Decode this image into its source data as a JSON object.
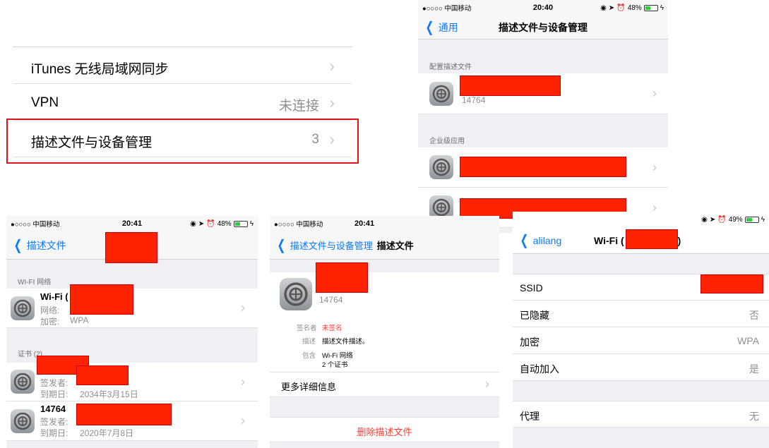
{
  "settings_excerpt": {
    "rows": [
      {
        "label": "iTunes 无线局域网同步",
        "value": ""
      },
      {
        "label": "VPN",
        "value": "未连接"
      },
      {
        "label": "描述文件与设备管理",
        "value": "3"
      }
    ]
  },
  "profiles_screen": {
    "status": {
      "carrier": "●○○○○ 中国移动",
      "time": "20:40",
      "battery": "48%"
    },
    "nav": {
      "back": "通用",
      "title": "描述文件与设备管理"
    },
    "sections": [
      {
        "header": "配置描述文件",
        "items": [
          {
            "sub": "14764"
          }
        ]
      },
      {
        "header": "企业级应用",
        "items": [
          {
            "sub": ""
          },
          {
            "sub": ""
          }
        ]
      }
    ]
  },
  "profile_detail_screen": {
    "status": {
      "carrier": "●○○○○ 中国移动",
      "time": "20:41",
      "battery": "48%"
    },
    "nav": {
      "back": "描述文件"
    },
    "wifi_header": "WI-FI 网络",
    "wifi": {
      "title": "Wi-Fi (",
      "network_label": "网络:",
      "encrypt_label": "加密:",
      "encrypt_value": "WPA"
    },
    "cert_header": "证书 (2)",
    "certs": [
      {
        "title": "",
        "issuer_label": "签发者:",
        "expiry_label": "到期日:",
        "expiry": "2034年3月15日"
      },
      {
        "title": "14764",
        "issuer_label": "签发者:",
        "expiry_label": "到期日:",
        "expiry": "2020年7月8日"
      }
    ]
  },
  "profile_screen": {
    "status": {
      "carrier": "●○○○○ 中国移动",
      "time": "20:41"
    },
    "nav": {
      "back": "描述文件与设备管理",
      "title": "描述文件"
    },
    "profile_sub": "14764",
    "signer_label": "签名者",
    "signer_value": "未签名",
    "desc_label": "描述",
    "desc_value": "描述文件描述。",
    "contains_label": "包含",
    "contains_value_1": "Wi-Fi 网络",
    "contains_value_2": "2 个证书",
    "more": "更多详细信息",
    "delete": "删除描述文件"
  },
  "wifi_screen": {
    "status": {
      "battery": "49%"
    },
    "nav": {
      "back": "alilang",
      "title_prefix": "Wi-Fi (",
      "title_suffix": ")"
    },
    "rows": [
      {
        "label": "SSID",
        "value": ""
      },
      {
        "label": "已隐藏",
        "value": "否"
      },
      {
        "label": "加密",
        "value": "WPA"
      },
      {
        "label": "自动加入",
        "value": "是"
      }
    ],
    "proxy": {
      "label": "代理",
      "value": "无"
    }
  },
  "colors": {
    "accent": "#0a7aff",
    "destructive": "#ff3b30",
    "highlight": "#d9151b",
    "redaction": "#ff2200"
  }
}
